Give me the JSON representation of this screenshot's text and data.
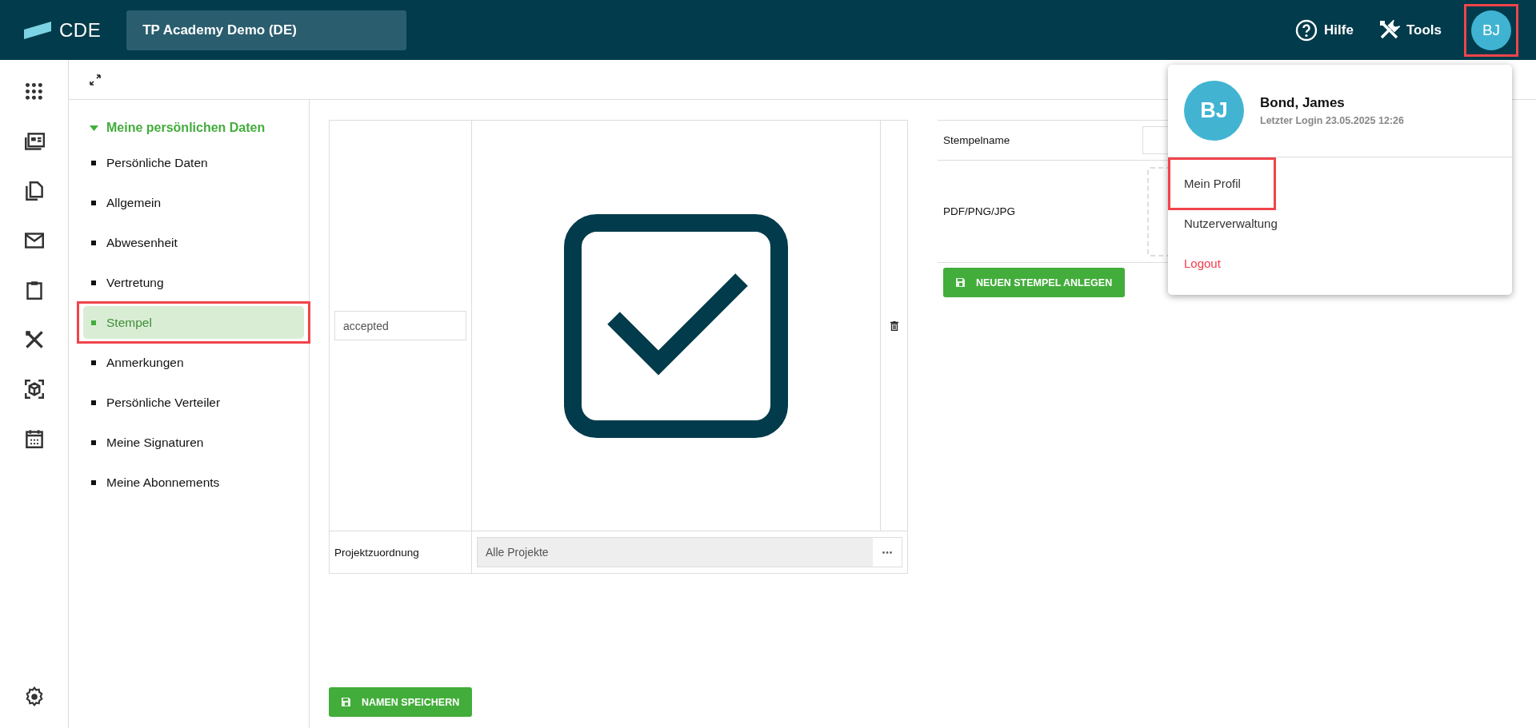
{
  "header": {
    "logo": "CDE",
    "project": "TP Academy Demo (DE)",
    "help": "Hilfe",
    "tools": "Tools",
    "avatar": {
      "initials": "BJ",
      "highlighted": true
    }
  },
  "nav": {
    "title": "Meine persönlichen Daten",
    "expanded": true,
    "items": [
      {
        "label": "Persönliche Daten",
        "selected": false,
        "highlighted": false
      },
      {
        "label": "Allgemein",
        "selected": false,
        "highlighted": false
      },
      {
        "label": "Abwesenheit",
        "selected": false,
        "highlighted": false
      },
      {
        "label": "Vertretung",
        "selected": false,
        "highlighted": false
      },
      {
        "label": "Stempel",
        "selected": true,
        "highlighted": true
      },
      {
        "label": "Anmerkungen",
        "selected": false,
        "highlighted": false
      },
      {
        "label": "Persönliche Verteiler",
        "selected": false,
        "highlighted": false
      },
      {
        "label": "Meine Signaturen",
        "selected": false,
        "highlighted": false
      },
      {
        "label": "Meine Abonnements",
        "selected": false,
        "highlighted": false
      }
    ]
  },
  "stamps": [
    {
      "name": "accepted",
      "project_label": "Projektzuordnung",
      "project": "Alle Projekte"
    }
  ],
  "save_button": "NAMEN SPEICHERN",
  "new_stamp": {
    "name_label": "Stempelname",
    "file_label": "PDF/PNG/JPG",
    "button": "NEUEN STEMPEL ANLEGEN"
  },
  "user_menu": {
    "initials": "BJ",
    "name": "Bond, James",
    "last_login": "Letzter Login 23.05.2025 12:26",
    "items": [
      {
        "label": "Mein Profil",
        "kind": "link",
        "highlighted": true
      },
      {
        "label": "Nutzerverwaltung",
        "kind": "link",
        "highlighted": false
      },
      {
        "label": "Logout",
        "kind": "danger",
        "highlighted": false
      }
    ]
  }
}
